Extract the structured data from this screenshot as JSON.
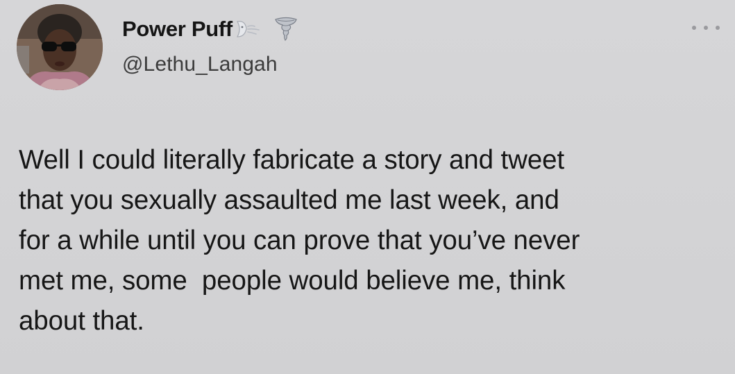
{
  "tweet": {
    "author": {
      "display_name": "Power Puff",
      "name_emojis": [
        "wind-face-emoji",
        "tornado-emoji"
      ],
      "handle": "@Lethu_Langah",
      "avatar_icon": "profile-photo"
    },
    "more_icon": "ellipsis-icon",
    "text": "Well I could literally fabricate a story and tweet\nthat you sexually assaulted me last week, and\nfor a while until you can prove that you’ve never\nmet me, some  people would believe me, think\nabout that."
  },
  "colors": {
    "background": "#d3d3d3",
    "text": "#161616",
    "handle": "#3b3b3b",
    "more_dots": "#9a9a9e"
  }
}
